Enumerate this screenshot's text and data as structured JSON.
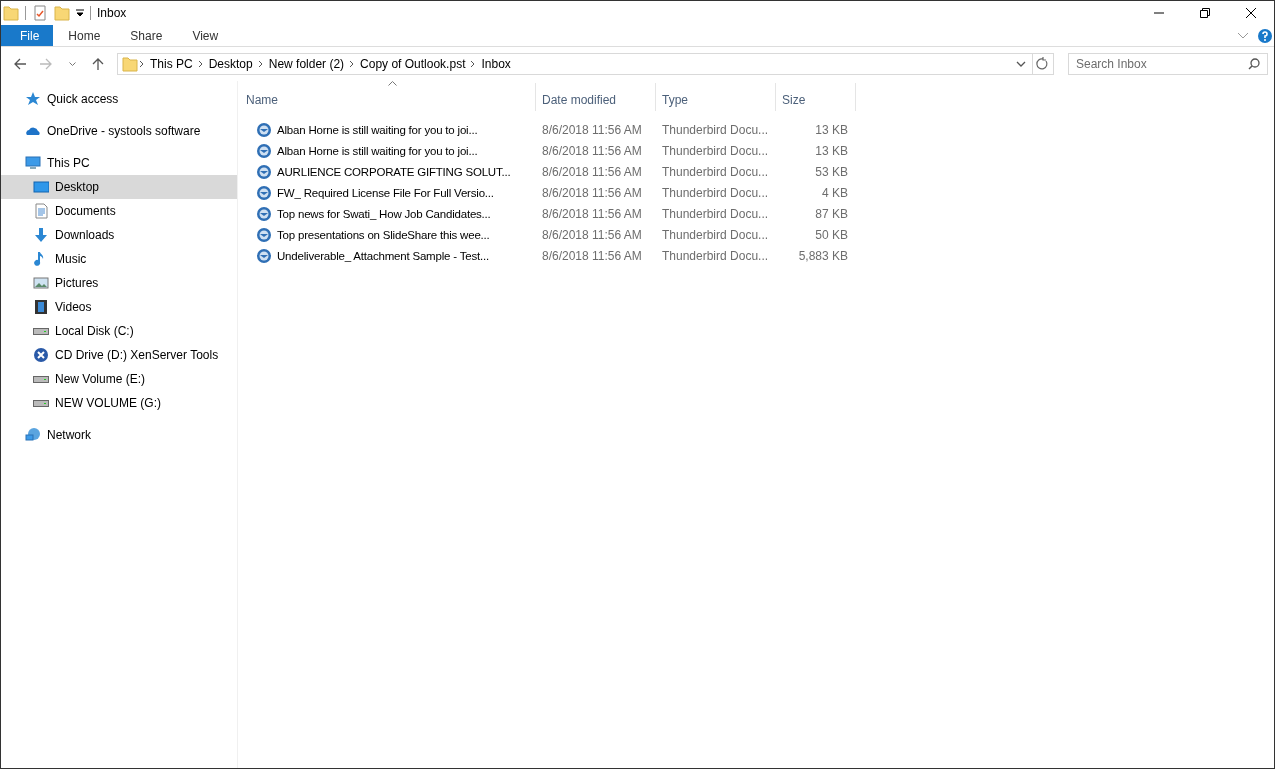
{
  "window": {
    "title": "Inbox"
  },
  "ribbon_tabs": [
    {
      "label": "File",
      "selected": true
    },
    {
      "label": "Home",
      "selected": false
    },
    {
      "label": "Share",
      "selected": false
    },
    {
      "label": "View",
      "selected": false
    }
  ],
  "breadcrumb": [
    "This PC",
    "Desktop",
    "New folder (2)",
    "Copy of Outlook.pst",
    "Inbox"
  ],
  "search": {
    "placeholder": "Search Inbox"
  },
  "sidebar": {
    "items": [
      {
        "label": "Quick access",
        "kind": "star",
        "selected": false
      },
      {
        "label": "OneDrive - systools software",
        "kind": "cloud",
        "selected": false
      },
      {
        "label": "This PC",
        "kind": "pc",
        "selected": false,
        "children": [
          {
            "label": "Desktop",
            "kind": "desktop",
            "selected": true
          },
          {
            "label": "Documents",
            "kind": "document",
            "selected": false
          },
          {
            "label": "Downloads",
            "kind": "download",
            "selected": false
          },
          {
            "label": "Music",
            "kind": "music",
            "selected": false
          },
          {
            "label": "Pictures",
            "kind": "picture",
            "selected": false
          },
          {
            "label": "Videos",
            "kind": "video",
            "selected": false
          },
          {
            "label": "Local Disk (C:)",
            "kind": "disk",
            "selected": false
          },
          {
            "label": "CD Drive (D:) XenServer Tools",
            "kind": "cd",
            "selected": false
          },
          {
            "label": "New Volume (E:)",
            "kind": "disk",
            "selected": false
          },
          {
            "label": "NEW VOLUME (G:)",
            "kind": "disk",
            "selected": false
          }
        ]
      },
      {
        "label": "Network",
        "kind": "network",
        "selected": false
      }
    ]
  },
  "table": {
    "columns": [
      {
        "label": "Name",
        "sorted": true
      },
      {
        "label": "Date modified",
        "sorted": false
      },
      {
        "label": "Type",
        "sorted": false
      },
      {
        "label": "Size",
        "sorted": false
      }
    ],
    "rows": [
      {
        "name": "Alban Horne is still waiting for you to joi...",
        "date": "8/6/2018 11:56 AM",
        "type": "Thunderbird Docu...",
        "size": "13 KB"
      },
      {
        "name": "Alban Horne is still waiting for you to joi...",
        "date": "8/6/2018 11:56 AM",
        "type": "Thunderbird Docu...",
        "size": "13 KB"
      },
      {
        "name": "AURLIENCE CORPORATE GIFTING SOLUT...",
        "date": "8/6/2018 11:56 AM",
        "type": "Thunderbird Docu...",
        "size": "53 KB"
      },
      {
        "name": "FW_ Required License File For Full Versio...",
        "date": "8/6/2018 11:56 AM",
        "type": "Thunderbird Docu...",
        "size": "4 KB"
      },
      {
        "name": "Top news for Swati_ How Job Candidates...",
        "date": "8/6/2018 11:56 AM",
        "type": "Thunderbird Docu...",
        "size": "87 KB"
      },
      {
        "name": "Top presentations on SlideShare this wee...",
        "date": "8/6/2018 11:56 AM",
        "type": "Thunderbird Docu...",
        "size": "50 KB"
      },
      {
        "name": "Undeliverable_ Attachment Sample - Test...",
        "date": "8/6/2018 11:56 AM",
        "type": "Thunderbird Docu...",
        "size": "5,883 KB"
      }
    ]
  }
}
